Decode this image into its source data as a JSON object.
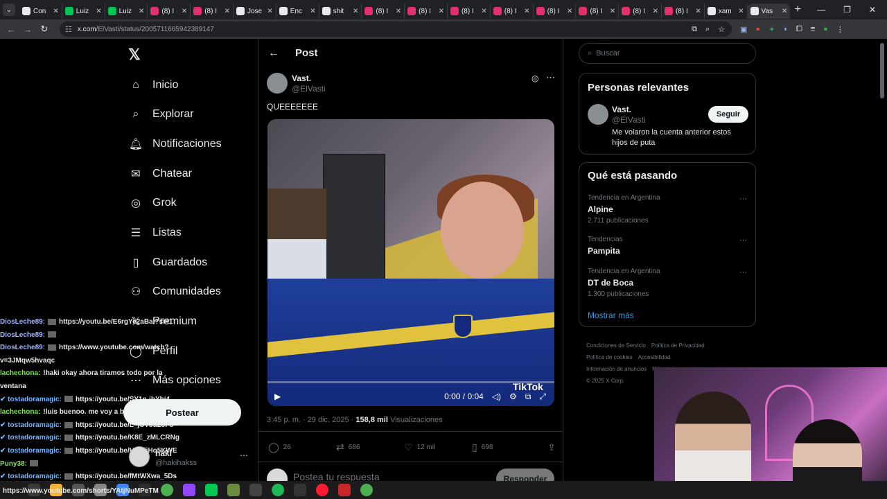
{
  "browser": {
    "tabs": [
      {
        "label": "Con",
        "color": "#e8eaed"
      },
      {
        "label": "Luiz",
        "color": "#00c853"
      },
      {
        "label": "Luiz",
        "color": "#00c853"
      },
      {
        "label": "(8) I",
        "color": "#e1306c"
      },
      {
        "label": "(8) I",
        "color": "#e1306c"
      },
      {
        "label": "Jose",
        "color": "#e8eaed"
      },
      {
        "label": "Enc",
        "color": "#e8eaed"
      },
      {
        "label": "shit",
        "color": "#e8eaed"
      },
      {
        "label": "(8) I",
        "color": "#e1306c"
      },
      {
        "label": "(8) I",
        "color": "#e1306c"
      },
      {
        "label": "(8) I",
        "color": "#e1306c"
      },
      {
        "label": "(8) I",
        "color": "#e1306c"
      },
      {
        "label": "(8) I",
        "color": "#e1306c"
      },
      {
        "label": "(8) I",
        "color": "#e1306c"
      },
      {
        "label": "(8) I",
        "color": "#e1306c"
      },
      {
        "label": "(8) I",
        "color": "#e1306c"
      },
      {
        "label": "xam",
        "color": "#e8eaed"
      },
      {
        "label": "Vas",
        "color": "#e8eaed"
      }
    ],
    "url_domain": "x.com",
    "url_path": "/ElVasti/status/2005711665942389147"
  },
  "nav": {
    "logo": "𝕏",
    "items": [
      {
        "label": "Inicio",
        "icon": "⌂"
      },
      {
        "label": "Explorar",
        "icon": "⌕"
      },
      {
        "label": "Notificaciones",
        "icon": "🔔︎"
      },
      {
        "label": "Chatear",
        "icon": "✉"
      },
      {
        "label": "Grok",
        "icon": "◎"
      },
      {
        "label": "Listas",
        "icon": "☰"
      },
      {
        "label": "Guardados",
        "icon": "▯"
      },
      {
        "label": "Comunidades",
        "icon": "⚇"
      },
      {
        "label": "Premium",
        "icon": "𝕏"
      },
      {
        "label": "Perfil",
        "icon": "◯"
      },
      {
        "label": "Más opciones",
        "icon": "⋯"
      }
    ],
    "post_button": "Postear",
    "account": {
      "name": "haki",
      "handle": "@hakihakss"
    }
  },
  "post": {
    "header": "Post",
    "author_name": "Vast.",
    "author_handle": "@ElVasti",
    "text": "QUEEEEEEE",
    "video_time": "0:00 / 0:04",
    "watermark": "TikTok",
    "time": "3:45 p. m. · 29 dic. 2025 · ",
    "views": "158,8 mil",
    "views_label": " Visualizaciones",
    "replies": "26",
    "reposts": "686",
    "likes": "12 mil",
    "bookmarks": "698",
    "reply_placeholder": "Postea tu respuesta",
    "reply_button": "Responder"
  },
  "sidebar": {
    "search_placeholder": "Buscar",
    "relevant_title": "Personas relevantes",
    "person": {
      "name": "Vast.",
      "handle": "@ElVasti",
      "bio": "Me volaron la cuenta anterior estos hijos de puta",
      "follow": "Seguir"
    },
    "trending_title": "Qué está pasando",
    "trends": [
      {
        "context": "Tendencia en Argentina",
        "name": "Alpine",
        "count": "2.711 publicaciones"
      },
      {
        "context": "Tendencias",
        "name": "Pampita",
        "count": ""
      },
      {
        "context": "Tendencia en Argentina",
        "name": "DT de Boca",
        "count": "1.300 publicaciones"
      }
    ],
    "show_more": "Mostrar más",
    "footer": [
      "Condiciones de Servicio",
      "Política de Privacidad",
      "Política de cookies",
      "Accesibilidad",
      "Información de anuncios",
      "Más opciones ...",
      "© 2025 X Corp."
    ]
  },
  "chat": [
    {
      "user": "DiosLeche89:",
      "color": "#9fb7ff",
      "thumb": true,
      "text": "https://youtu.be/E6rgYe2aBal?si=1"
    },
    {
      "user": "DiosLeche89:",
      "color": "#9fb7ff",
      "thumb": true,
      "text": ""
    },
    {
      "user": "DiosLeche89:",
      "color": "#9fb7ff",
      "thumb": true,
      "text": "https://www.youtube.com/watch?"
    },
    {
      "user": "",
      "color": "#e7e9ea",
      "thumb": false,
      "text": "v=3JMqw5hvaqc"
    },
    {
      "user": "lachechona:",
      "color": "#86e35a",
      "thumb": false,
      "text": "!haki okay ahora tiramos todo por la"
    },
    {
      "user": "",
      "color": "#e7e9ea",
      "thumb": false,
      "text": "ventana"
    },
    {
      "user": "✔ tostadoramagic:",
      "color": "#6fb3ff",
      "thumb": true,
      "text": "https://youtu.be/SY1n-ibYbi4"
    },
    {
      "user": "lachechona:",
      "color": "#86e35a",
      "thumb": false,
      "text": "!luis buenoo. me voy a bañar"
    },
    {
      "user": "✔ tostadoramagic:",
      "color": "#6fb3ff",
      "thumb": true,
      "text": "https://youtu.be/L_jUY8u2oFo"
    },
    {
      "user": "✔ tostadoramagic:",
      "color": "#6fb3ff",
      "thumb": true,
      "text": "https://youtu.be/K8E_zMLCRNg"
    },
    {
      "user": "✔ tostadoramagic:",
      "color": "#6fb3ff",
      "thumb": true,
      "text": "https://youtu.be/HIGdjHo5KWE"
    },
    {
      "user": "Puny38:",
      "color": "#86e35a",
      "thumb": true,
      "text": ""
    },
    {
      "user": "✔ tostadoramagic:",
      "color": "#6fb3ff",
      "thumb": true,
      "text": "https://youtu.be/fMtWXwa_5Ds"
    }
  ],
  "taskbar_url": "https://www.youtube.com/shorts/YAtjNuMPeTM"
}
